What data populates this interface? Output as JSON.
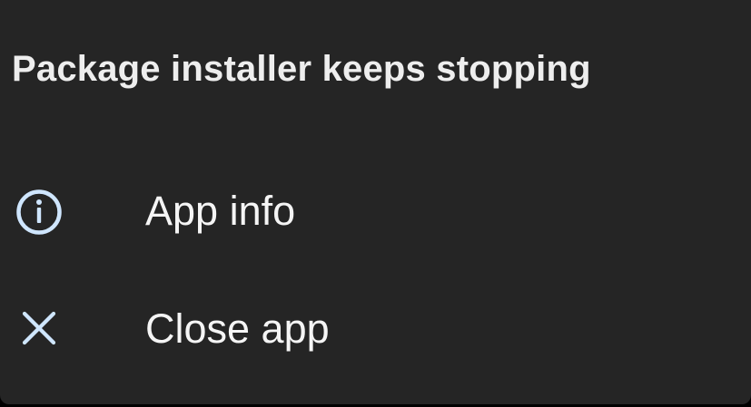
{
  "dialog": {
    "title": "Package installer keeps stopping",
    "actions": [
      {
        "label": "App info",
        "icon": "info-icon"
      },
      {
        "label": "Close app",
        "icon": "close-icon"
      }
    ]
  },
  "colors": {
    "surface": "#252525",
    "backdrop": "#000000",
    "icon_tint": "#cfe6ff",
    "text": "#f5f5f5"
  }
}
